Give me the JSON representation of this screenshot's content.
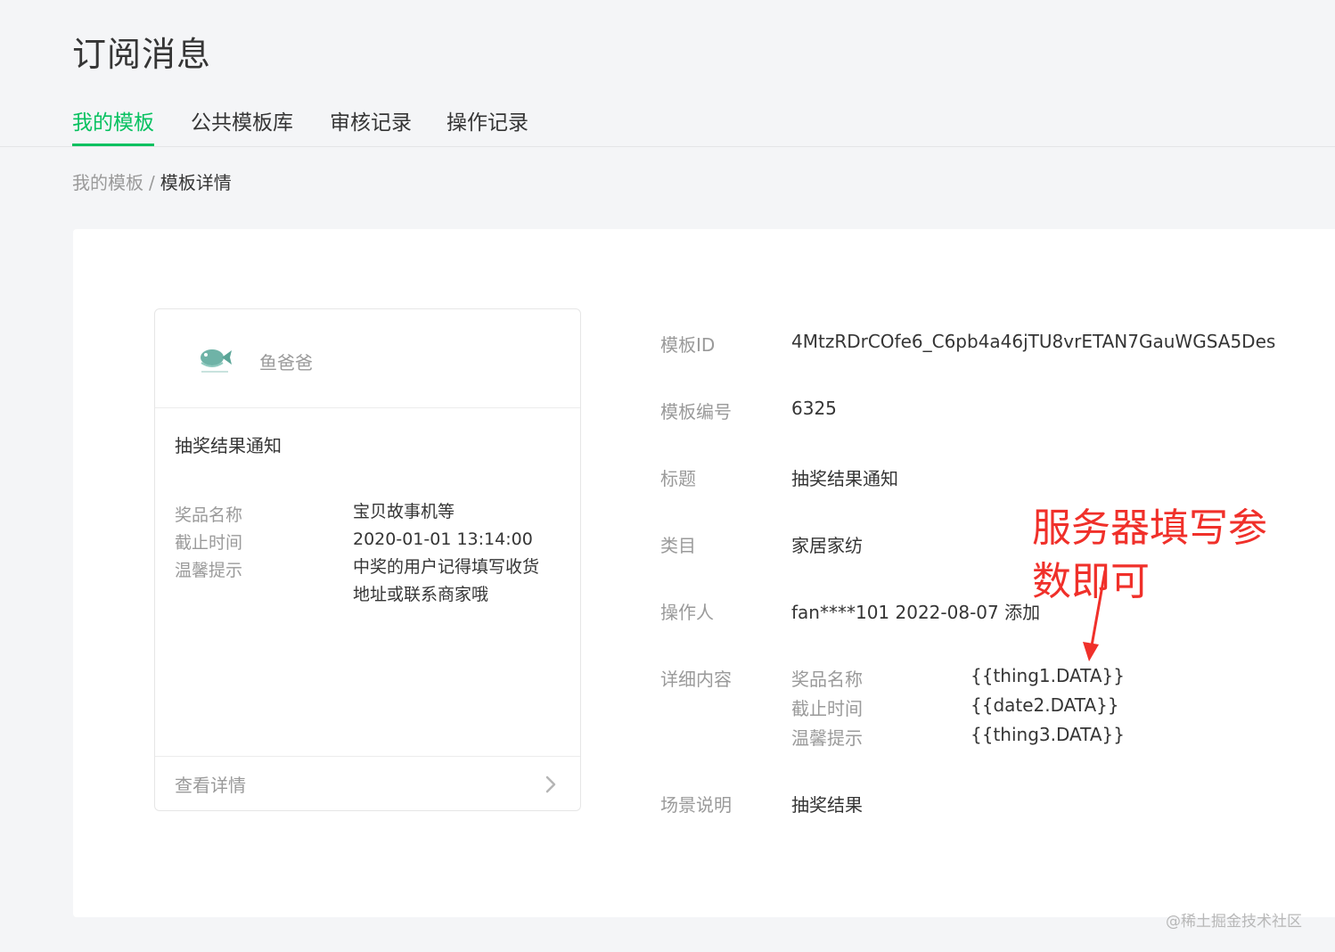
{
  "page": {
    "title": "订阅消息",
    "tabs": [
      {
        "label": "我的模板",
        "active": true
      },
      {
        "label": "公共模板库",
        "active": false
      },
      {
        "label": "审核记录",
        "active": false
      },
      {
        "label": "操作记录",
        "active": false
      }
    ],
    "breadcrumb": {
      "parent": "我的模板",
      "separator": "/",
      "current": "模板详情"
    },
    "accent_color": "#07c160"
  },
  "preview_card": {
    "account_name": "鱼爸爸",
    "logo_icon": "fish-logo-icon",
    "message_title": "抽奖结果通知",
    "fields": [
      {
        "key": "奖品名称",
        "value": "宝贝故事机等"
      },
      {
        "key": "截止时间",
        "value": "2020-01-01 13:14:00"
      },
      {
        "key": "温馨提示",
        "value": "中奖的用户记得填写收货地址或联系商家哦"
      }
    ],
    "footer_label": "查看详情",
    "footer_icon": "chevron-right-icon"
  },
  "details": {
    "template_id": {
      "label": "模板ID",
      "value": "4MtzRDrCOfe6_C6pb4a46jTU8vrETAN7GauWGSA5Des"
    },
    "template_no": {
      "label": "模板编号",
      "value": "6325"
    },
    "title": {
      "label": "标题",
      "value": "抽奖结果通知"
    },
    "category": {
      "label": "类目",
      "value": "家居家纺"
    },
    "operator": {
      "label": "操作人",
      "value": "fan****101 2022-08-07 添加"
    },
    "content": {
      "label": "详细内容",
      "rows": [
        {
          "key": "奖品名称",
          "value": "{{thing1.DATA}}"
        },
        {
          "key": "截止时间",
          "value": "{{date2.DATA}}"
        },
        {
          "key": "温馨提示",
          "value": "{{thing3.DATA}}"
        }
      ]
    },
    "scene": {
      "label": "场景说明",
      "value": "抽奖结果"
    }
  },
  "annotation": {
    "text": "服务器填写参数即可",
    "color": "#f0302a"
  },
  "watermark": "@稀土掘金技术社区"
}
